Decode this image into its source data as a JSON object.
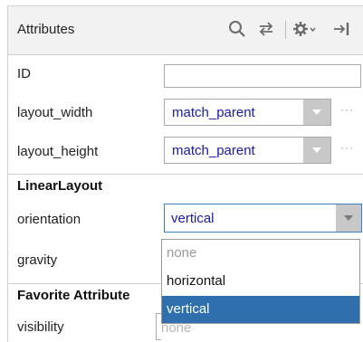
{
  "header": {
    "title": "Attributes",
    "icons": [
      "search-icon",
      "swap-icon",
      "gear-icon",
      "pin-icon"
    ]
  },
  "attributes": {
    "id": {
      "label": "ID",
      "value": ""
    },
    "layout_width": {
      "label": "layout_width",
      "value": "match_parent",
      "more": "···"
    },
    "layout_height": {
      "label": "layout_height",
      "value": "match_parent",
      "more": "···"
    }
  },
  "sections": {
    "linear_layout": "LinearLayout",
    "favorite": "Favorite Attribute"
  },
  "linear": {
    "orientation": {
      "label": "orientation",
      "value": "vertical"
    },
    "gravity": {
      "label": "gravity"
    }
  },
  "dropdown": {
    "options": [
      {
        "label": "none",
        "state": "disabled"
      },
      {
        "label": "horizontal",
        "state": "normal"
      },
      {
        "label": "vertical",
        "state": "selected"
      }
    ]
  },
  "favorite": {
    "visibility": {
      "label": "visibility",
      "value": "none"
    }
  },
  "colors": {
    "accent_blue": "#2f6fae",
    "value_text": "#1a1aa6",
    "focus_border": "#3b7fc4"
  }
}
